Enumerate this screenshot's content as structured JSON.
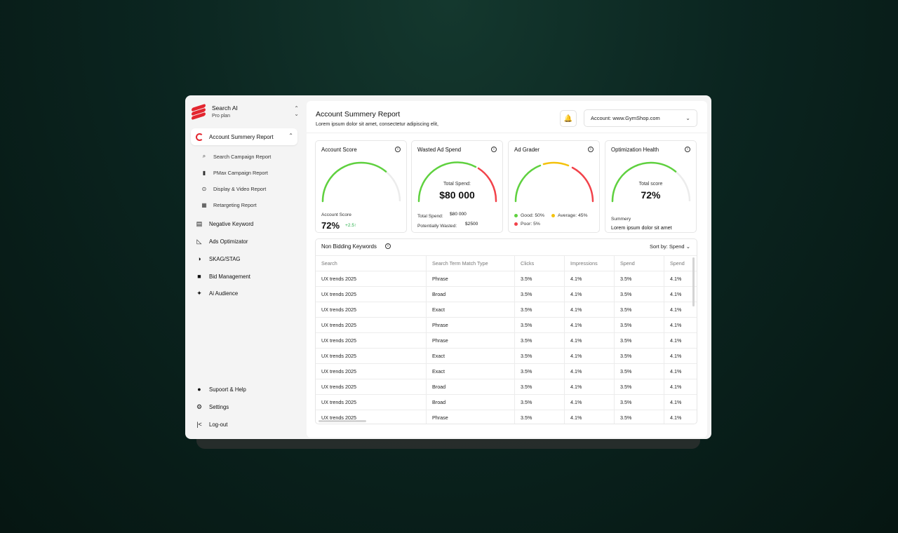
{
  "brand": {
    "name": "Search AI",
    "plan": "Pro plan"
  },
  "sidebar": {
    "active": "Account Summery Report",
    "sub_items": [
      {
        "icon": "search-icon",
        "label": "Search Campaign Report"
      },
      {
        "icon": "bar-chart-icon",
        "label": "PMax Campaign Report"
      },
      {
        "icon": "play-circle-icon",
        "label": "Display & Video Report"
      },
      {
        "icon": "report-icon",
        "label": "Retargeting Report"
      }
    ],
    "items": [
      {
        "icon": "list-icon",
        "label": "Negative Keyword"
      },
      {
        "icon": "optimizer-icon",
        "label": "Ads Optimizator"
      },
      {
        "icon": "pie-icon",
        "label": "SKAG/STAG"
      },
      {
        "icon": "briefcase-icon",
        "label": "Bid Management"
      },
      {
        "icon": "sparkle-icon",
        "label": "Ai Audience"
      }
    ],
    "bottom": [
      {
        "icon": "alert-icon",
        "label": "Supoort & Help"
      },
      {
        "icon": "gear-icon",
        "label": "Settings"
      },
      {
        "icon": "logout-icon",
        "label": "Log-out"
      }
    ]
  },
  "header": {
    "title": "Account Summery Report",
    "subtitle": "Lorem ipsum dolor sit amet, consectetur adipiscing elit,",
    "account": "Account: www.GymShop.com"
  },
  "cards": {
    "account_score": {
      "title": "Account Score",
      "caption": "Account Score",
      "value": "72%",
      "delta": "+2.5↑",
      "fraction": 0.72
    },
    "wasted": {
      "title": "Wasted Ad Spend",
      "center_label": "Total Spend:",
      "center_value": "$80 000",
      "spend_label": "Total Spend:",
      "spend_value": "$80 000",
      "wasted_label": "Potentially Wasted:",
      "wasted_value": "$2500"
    },
    "ad_grader": {
      "title": "Ad Grader",
      "good": "Good: 50%",
      "average": "Average: 45%",
      "poor": "Poor: 5%"
    },
    "health": {
      "title": "Optimization Health",
      "center_label": "Total score",
      "center_value": "72%",
      "summary_label": "Summery",
      "summary_text": "Lorem ipsum dolor sit amet",
      "fraction": 0.72
    }
  },
  "table": {
    "title": "Non Bidding Keywords",
    "sort": "Sort by: Spend",
    "columns": [
      "Search",
      "Search Term Match Type",
      "Clicks",
      "Impressions",
      "Spend",
      "Spend"
    ],
    "rows": [
      [
        "UX trends 2025",
        "Phrase",
        "3.5%",
        "4.1%",
        "3.5%",
        "4.1%"
      ],
      [
        "UX trends 2025",
        "Broad",
        "3.5%",
        "4.1%",
        "3.5%",
        "4.1%"
      ],
      [
        "UX trends 2025",
        "Exact",
        "3.5%",
        "4.1%",
        "3.5%",
        "4.1%"
      ],
      [
        "UX trends 2025",
        "Phrase",
        "3.5%",
        "4.1%",
        "3.5%",
        "4.1%"
      ],
      [
        "UX trends 2025",
        "Phrase",
        "3.5%",
        "4.1%",
        "3.5%",
        "4.1%"
      ],
      [
        "UX trends 2025",
        "Exact",
        "3.5%",
        "4.1%",
        "3.5%",
        "4.1%"
      ],
      [
        "UX trends 2025",
        "Exact",
        "3.5%",
        "4.1%",
        "3.5%",
        "4.1%"
      ],
      [
        "UX trends 2025",
        "Broad",
        "3.5%",
        "4.1%",
        "3.5%",
        "4.1%"
      ],
      [
        "UX trends 2025",
        "Broad",
        "3.5%",
        "4.1%",
        "3.5%",
        "4.1%"
      ],
      [
        "UX trends 2025",
        "Phrase",
        "3.5%",
        "4.1%",
        "3.5%",
        "4.1%"
      ]
    ]
  },
  "colors": {
    "accent_red": "#e3262f",
    "green": "#5fd13f",
    "yellow": "#f4c20d",
    "red": "#f2424a"
  }
}
